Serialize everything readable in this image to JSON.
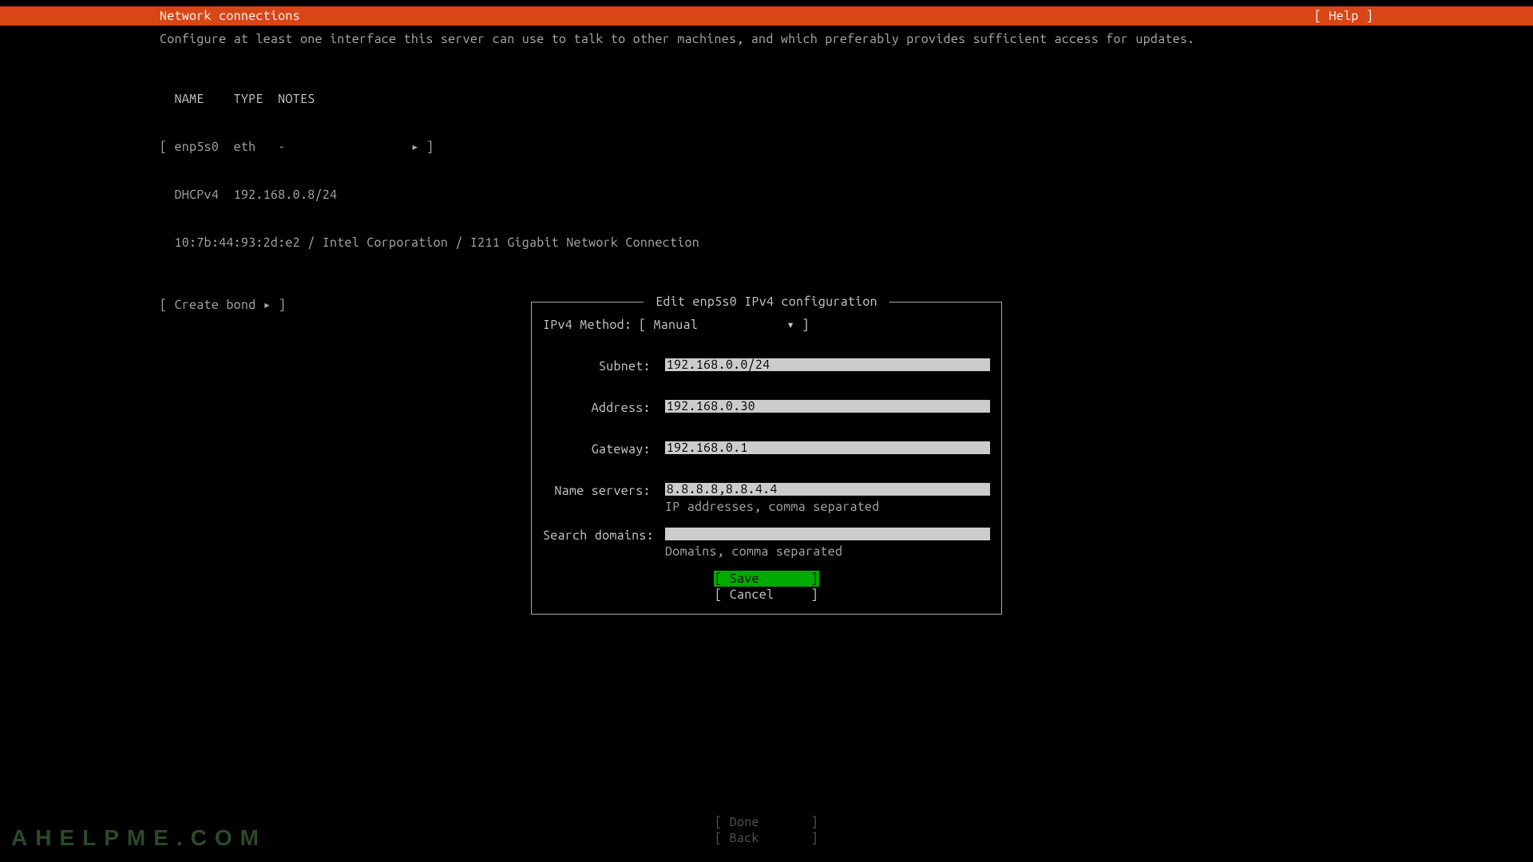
{
  "header": {
    "title": "Network connections",
    "help": "[ Help ]"
  },
  "intro": "Configure at least one interface this server can use to talk to other machines, and which preferably provides sufficient access for updates.",
  "nic": {
    "header": "  NAME    TYPE  NOTES",
    "row": "[ enp5s0  eth   -                 ▸ ]",
    "dhcp": "  DHCPv4  192.168.0.8/24",
    "mac": "  10:7b:44:93:2d:e2 / Intel Corporation / I211 Gigabit Network Connection"
  },
  "create_bond": "[ Create bond ▸ ]",
  "dialog": {
    "title": " Edit enp5s0 IPv4 configuration ",
    "method_label": "IPv4 Method:   ",
    "method_value": "[ Manual            ▾ ]",
    "subnet_label": "Subnet:",
    "subnet_value": "192.168.0.0/24",
    "address_label": "Address:",
    "address_value": "192.168.0.30",
    "gateway_label": "Gateway:",
    "gateway_value": "192.168.0.1",
    "nameservers_label": "Name servers:",
    "nameservers_value": "8.8.8.8,8.8.4.4",
    "nameservers_hint": "IP addresses, comma separated",
    "searchdomains_label": "Search domains:",
    "searchdomains_value": "",
    "searchdomains_hint": "Domains, comma separated",
    "save": "[ Save       ]",
    "cancel": "[ Cancel     ]"
  },
  "footer": {
    "done": "[ Done       ]",
    "back": "[ Back       ]"
  },
  "watermark": "AHELPME.COM"
}
